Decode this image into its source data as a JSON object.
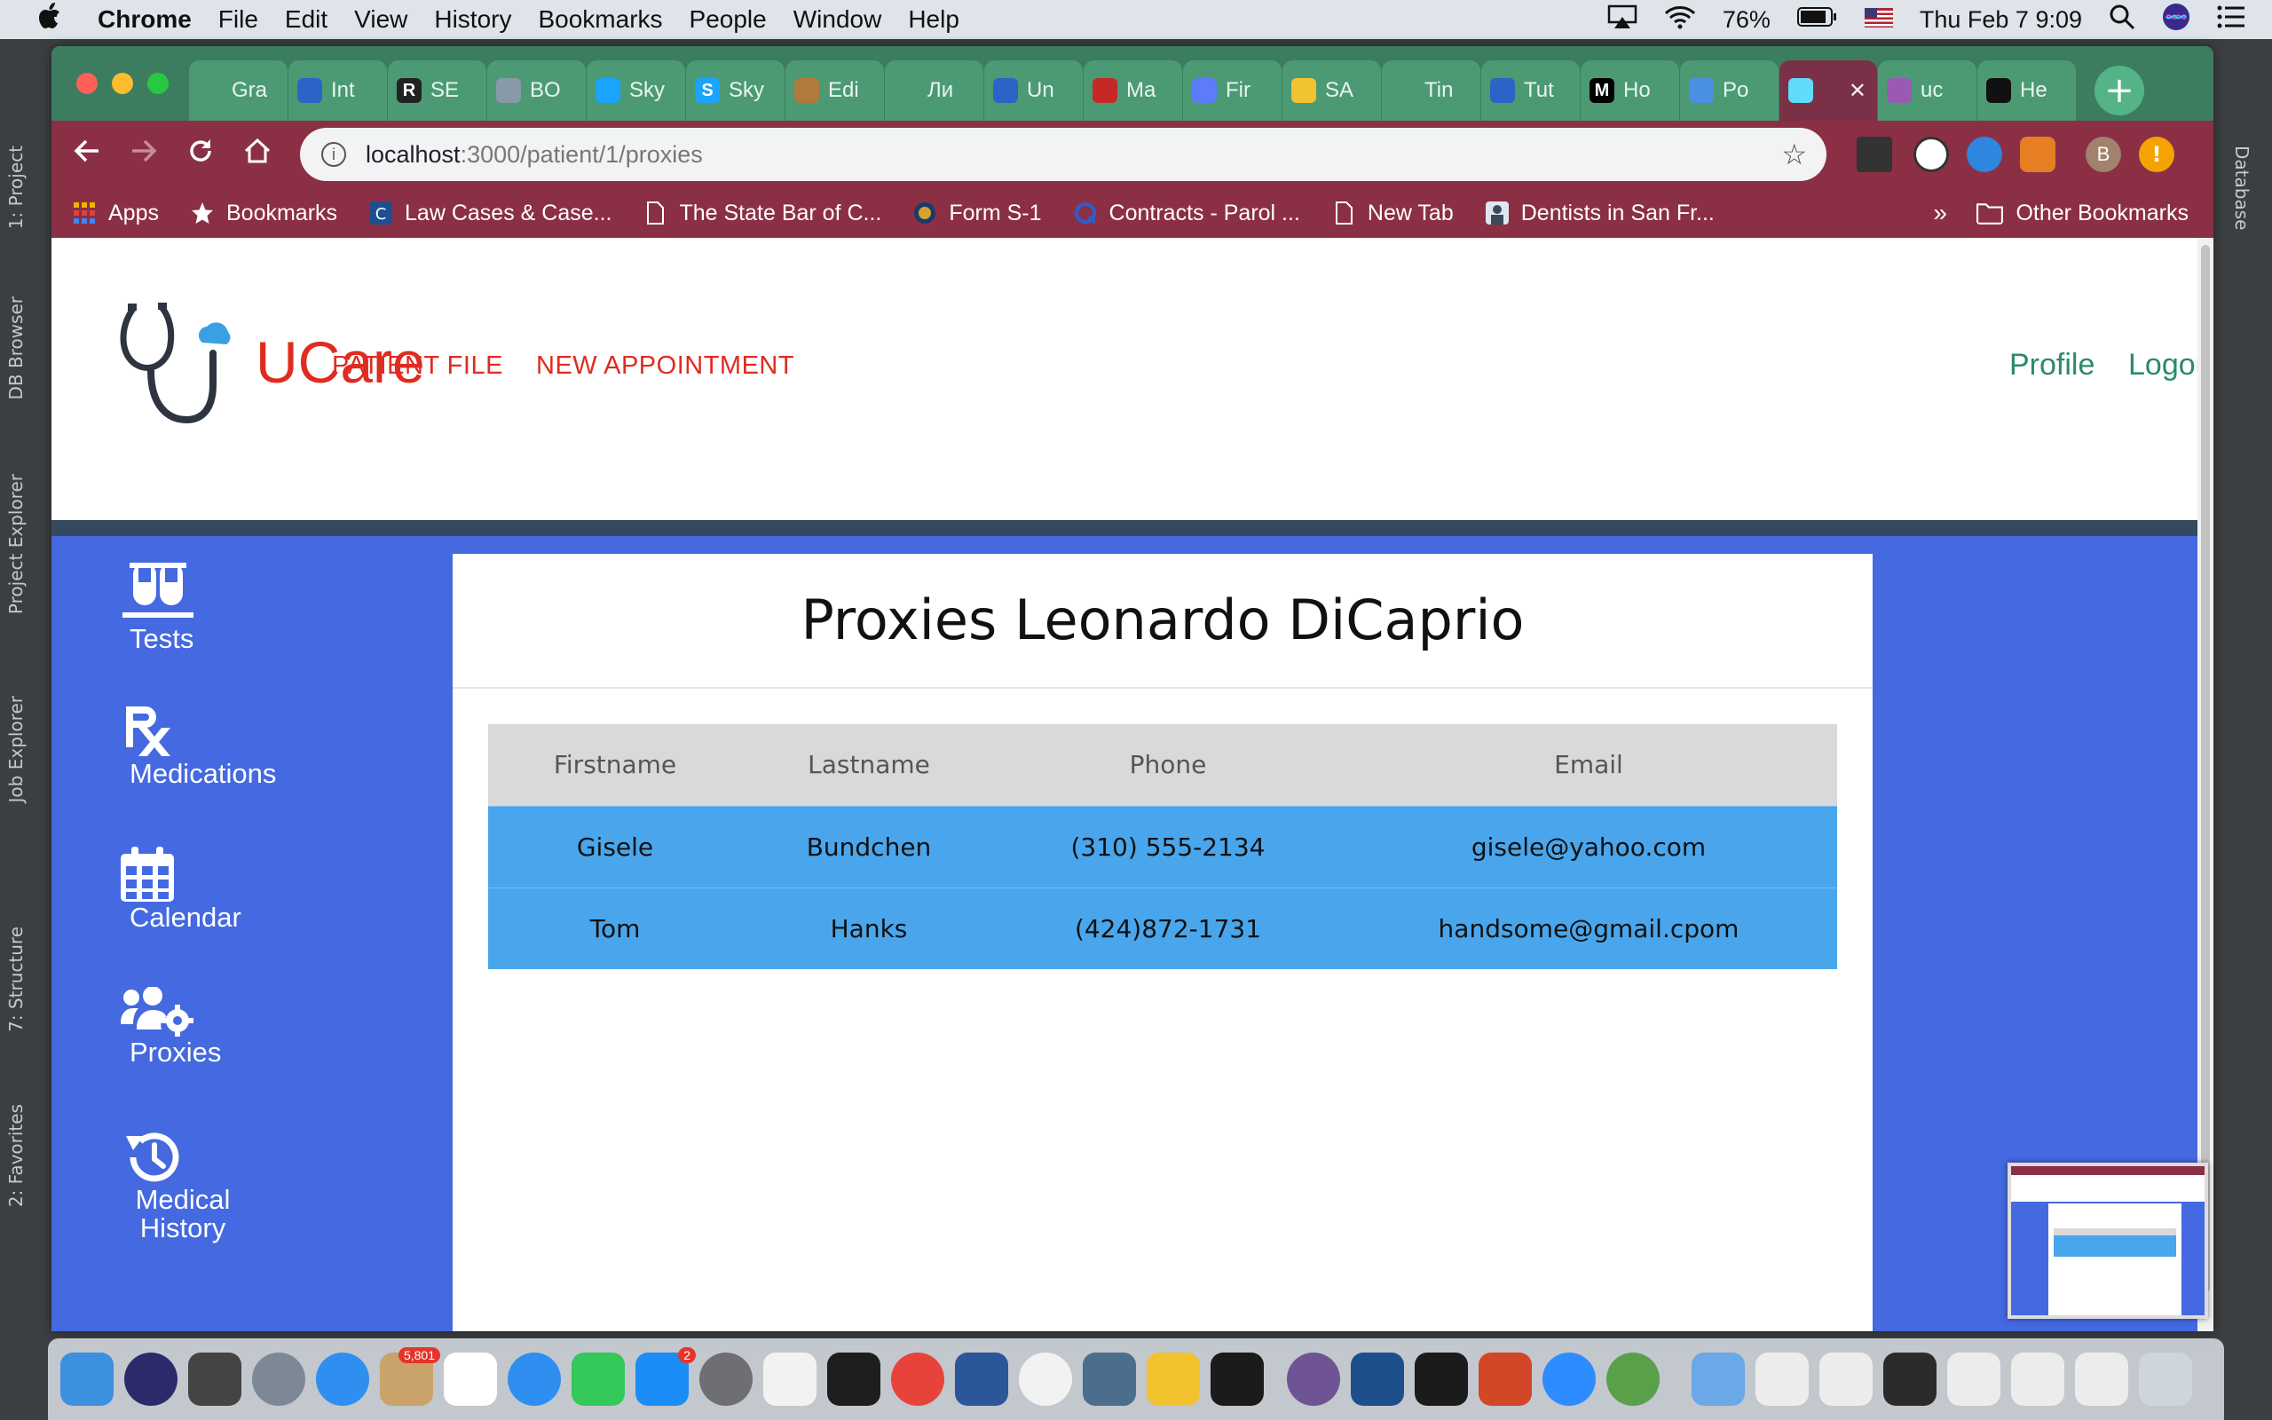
{
  "menubar": {
    "apple": "",
    "app": "Chrome",
    "items": [
      "File",
      "Edit",
      "View",
      "History",
      "Bookmarks",
      "People",
      "Window",
      "Help"
    ],
    "battery": "76%",
    "datetime": "Thu Feb 7  9:09"
  },
  "ide": {
    "left_tabs": [
      "1: Project",
      "DB Browser",
      "Project Explorer",
      "Job Explorer",
      "7: Structure",
      "2: Favorites"
    ],
    "right_tab": "Database"
  },
  "browser": {
    "tabs": [
      {
        "label": "Gra",
        "color": "#4c9a73"
      },
      {
        "label": "Int",
        "color": "#2a64c6"
      },
      {
        "label": "SE",
        "color": "#222222",
        "glyph": "R"
      },
      {
        "label": "BO",
        "color": "#8899aa"
      },
      {
        "label": "Sky",
        "color": "#1aa3ff"
      },
      {
        "label": "Sky",
        "color": "#1aa3ff",
        "glyph": "S"
      },
      {
        "label": "Edi",
        "color": "#b07a3c"
      },
      {
        "label": "Ли",
        "color": "#4c9a73"
      },
      {
        "label": "Un",
        "color": "#2a64c6"
      },
      {
        "label": "Ma",
        "color": "#c62828"
      },
      {
        "label": "Fir",
        "color": "#5c7cfa"
      },
      {
        "label": "SA",
        "color": "#f1c232"
      },
      {
        "label": "Tin",
        "color": "#4c9a73"
      },
      {
        "label": "Tut",
        "color": "#2a64c6"
      },
      {
        "label": "Ho",
        "color": "#000000",
        "glyph": "M"
      },
      {
        "label": "Po",
        "color": "#4a90e2"
      },
      {
        "label": "",
        "color": "#61dafb",
        "active": true
      },
      {
        "label": "uc",
        "color": "#9b59b6"
      },
      {
        "label": "He",
        "color": "#111111"
      }
    ],
    "url_host": "localhost",
    "url_path": ":3000/patient/1/proxies",
    "bookmarks": [
      {
        "label": "Apps",
        "icon": "apps-icon"
      },
      {
        "label": "Bookmarks",
        "icon": "star-icon"
      },
      {
        "label": "Law Cases & Case...",
        "icon": "c-logo-icon"
      },
      {
        "label": "The State Bar of C...",
        "icon": "page-icon"
      },
      {
        "label": "Form S-1",
        "icon": "seal-icon"
      },
      {
        "label": "Contracts - Parol ...",
        "icon": "q-icon"
      },
      {
        "label": "New Tab",
        "icon": "page-icon"
      },
      {
        "label": "Dentists in San Fr...",
        "icon": "dentist-icon"
      }
    ],
    "more": "»",
    "other_bookmarks": "Other Bookmarks",
    "profile_initial": "B"
  },
  "app": {
    "brand": "UCare",
    "nav": [
      "PATIENT FILE",
      "NEW APPOINTMENT"
    ],
    "nav_right": [
      "Profile",
      "Logout"
    ],
    "colors": {
      "brand": "#e02b20",
      "nav_right": "#2b8a6e",
      "sidebar": "#4469e0",
      "row": "#4aa6ec"
    },
    "sidebar": [
      {
        "label": "Tests",
        "icon": "test-tubes-icon"
      },
      {
        "label": "Medications",
        "icon": "rx-icon"
      },
      {
        "label": "Calendar",
        "icon": "calendar-icon"
      },
      {
        "label": "Proxies",
        "icon": "users-cog-icon"
      },
      {
        "label": "Medical History",
        "icon": "history-icon"
      }
    ],
    "page_title": "Proxies Leonardo DiCaprio",
    "table": {
      "headers": [
        "Firstname",
        "Lastname",
        "Phone",
        "Email"
      ],
      "rows": [
        [
          "Gisele",
          "Bundchen",
          "(310) 555-2134",
          "gisele@yahoo.com"
        ],
        [
          "Tom",
          "Hanks",
          "(424)872-1731",
          "handsome@gmail.cpom"
        ]
      ]
    }
  }
}
